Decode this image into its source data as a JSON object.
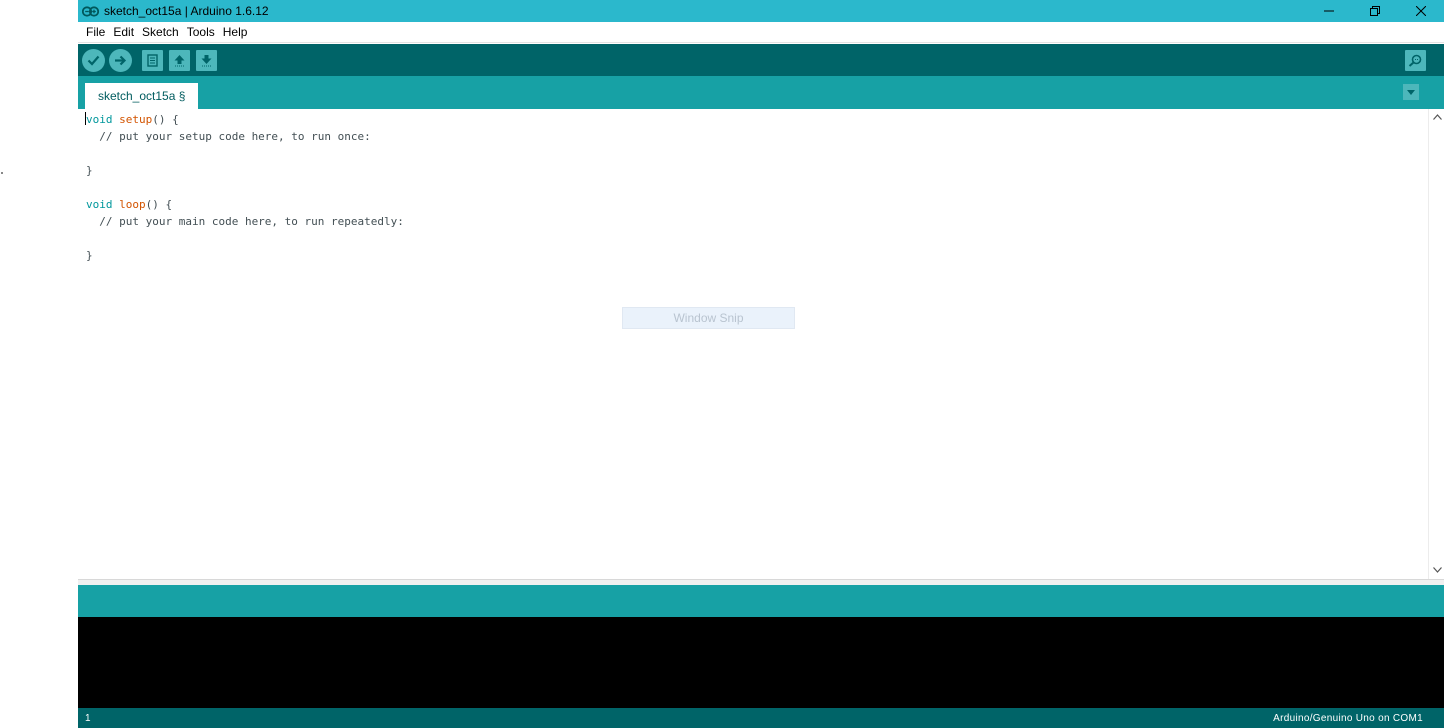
{
  "window": {
    "title": "sketch_oct15a | Arduino 1.6.12"
  },
  "menubar": {
    "items": [
      "File",
      "Edit",
      "Sketch",
      "Tools",
      "Help"
    ]
  },
  "toolbar": {
    "buttons": [
      "verify-icon",
      "upload-icon",
      "new-icon",
      "open-icon",
      "save-icon",
      "serial-monitor-icon"
    ]
  },
  "tabs": [
    {
      "label": "sketch_oct15a §"
    }
  ],
  "editor": {
    "lines": [
      {
        "kw": "void",
        "fn": "setup",
        "rest": "() {"
      },
      {
        "comment": "  // put your setup code here, to run once:"
      },
      {
        "text": ""
      },
      {
        "text": "}"
      },
      {
        "text": ""
      },
      {
        "kw": "void",
        "fn": "loop",
        "rest": "() {"
      },
      {
        "comment": "  // put your main code here, to run repeatedly:"
      },
      {
        "text": ""
      },
      {
        "text": "}"
      }
    ]
  },
  "overlay": {
    "label": "Window Snip"
  },
  "status": {
    "line_number": "1",
    "board": "Arduino/Genuino Uno on COM1"
  },
  "colors": {
    "titlebar": "#2bb8cc",
    "toolbar": "#006468",
    "tabbar": "#17a1a5",
    "button": "#4db7bb",
    "keyword": "#00979c",
    "function": "#d35400"
  }
}
